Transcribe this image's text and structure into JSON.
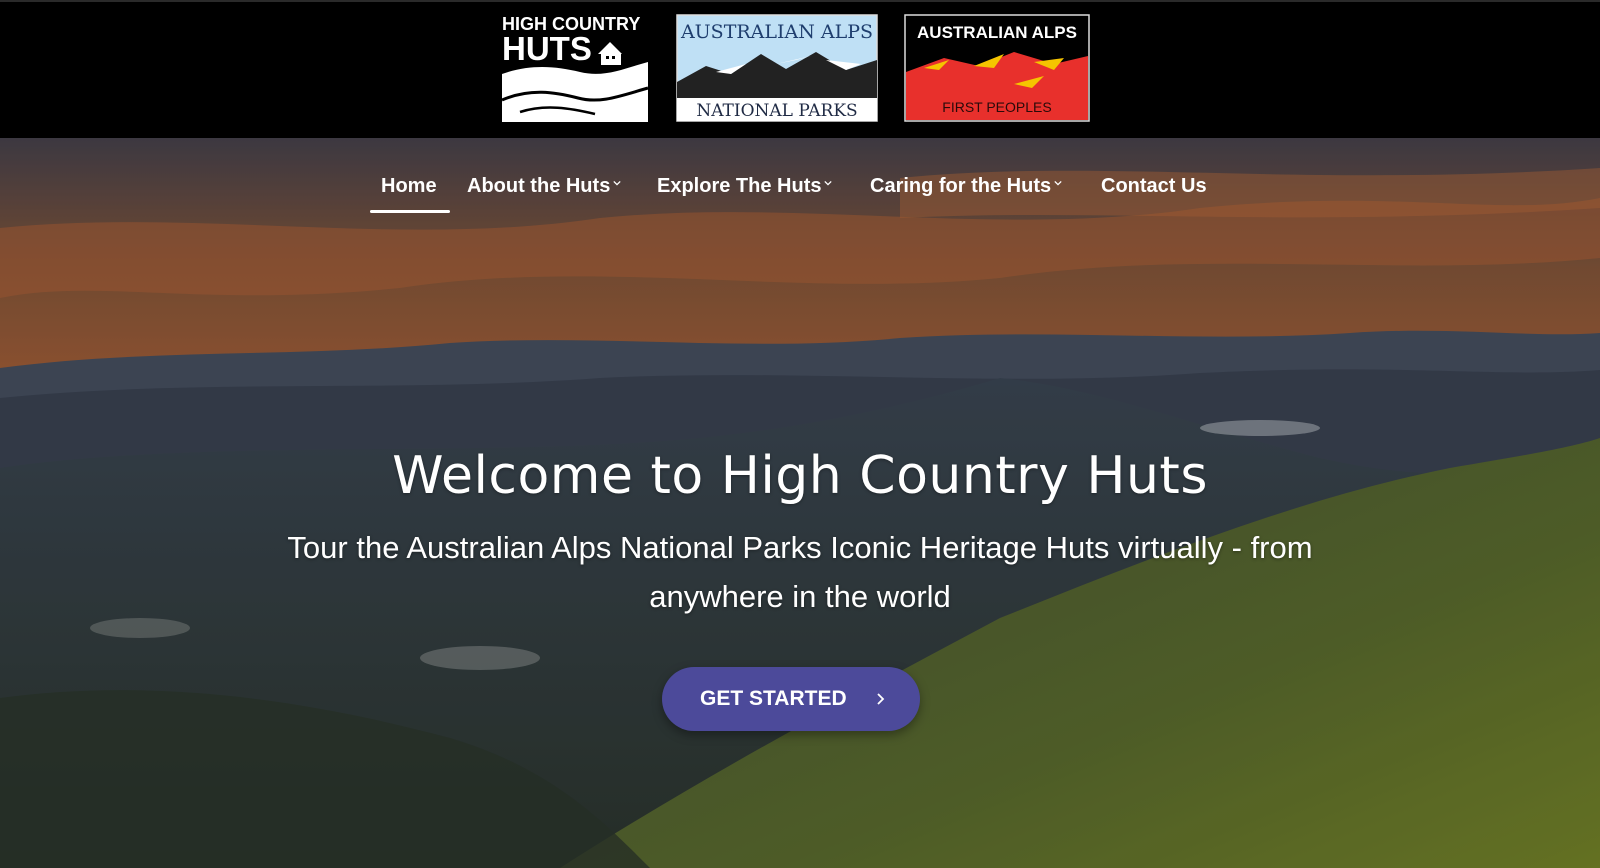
{
  "logos": {
    "huts": {
      "line1": "HIGH COUNTRY",
      "line2": "HUTS"
    },
    "alps_parks": {
      "top": "AUSTRALIAN ALPS",
      "bottom": "NATIONAL PARKS"
    },
    "alps_first": {
      "top": "AUSTRALIAN ALPS",
      "bottom": "FIRST PEOPLES"
    }
  },
  "nav": {
    "items": [
      {
        "label": "Home",
        "active": true
      },
      {
        "label": "About the Huts",
        "dropdown": true
      },
      {
        "label": "Explore The Huts",
        "dropdown": true
      },
      {
        "label": "Caring for the Huts",
        "dropdown": true
      },
      {
        "label": "Contact Us"
      }
    ]
  },
  "hero": {
    "title": "Welcome to High Country Huts",
    "subtitle": "Tour the Australian Alps National Parks Iconic Heritage Huts virtually - from anywhere in the world",
    "cta_label": "GET STARTED",
    "cta_icon": "chevron-right-icon"
  },
  "colors": {
    "header_bg": "#000000",
    "cta_bg": "#4c4a9a",
    "alps_parks_sky": "#bfe0f5",
    "alps_first_red": "#e8302c",
    "alps_first_yellow": "#f5c400"
  }
}
